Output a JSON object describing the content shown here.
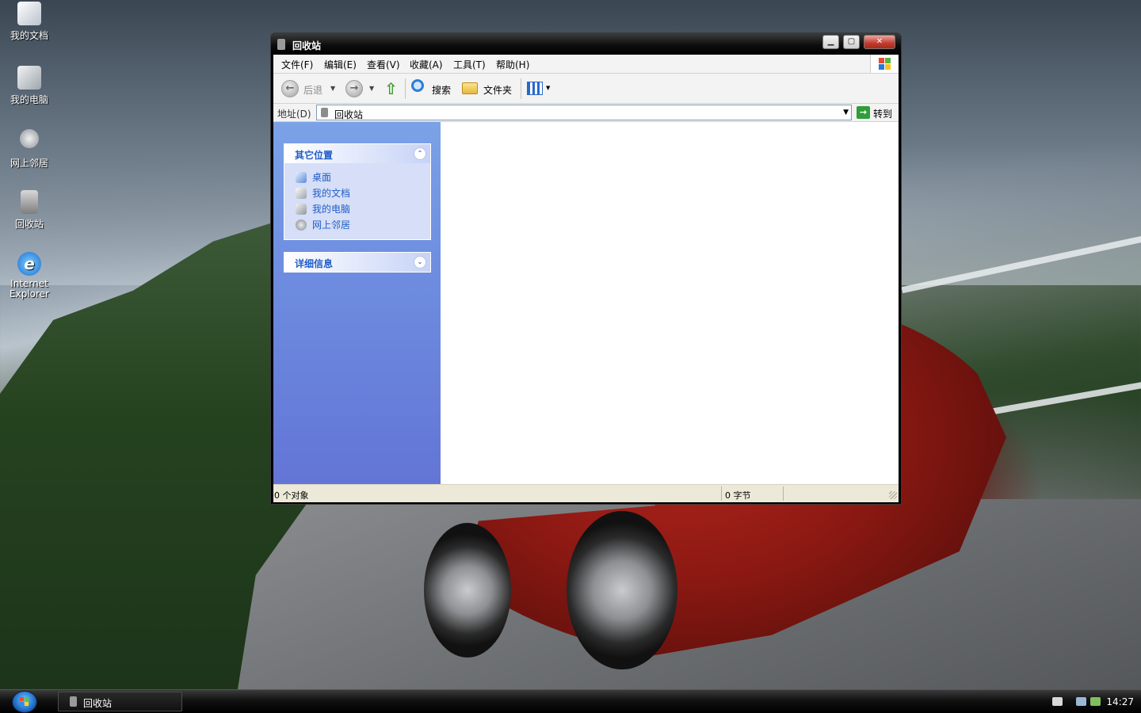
{
  "desktop": {
    "icons": [
      {
        "label": "我的文档"
      },
      {
        "label": "我的电脑"
      },
      {
        "label": "网上邻居"
      },
      {
        "label": "回收站"
      },
      {
        "label": "Internet Explorer"
      }
    ]
  },
  "window": {
    "title": "回收站",
    "menu": [
      "文件(F)",
      "编辑(E)",
      "查看(V)",
      "收藏(A)",
      "工具(T)",
      "帮助(H)"
    ],
    "toolbar": {
      "back_label": "后退",
      "search_label": "搜索",
      "folders_label": "文件夹"
    },
    "address": {
      "label": "地址(D)",
      "value": "回收站",
      "go_label": "转到"
    },
    "sidebar": {
      "panel1": {
        "title": "其它位置",
        "links": [
          {
            "label": "桌面",
            "icon": "desktop-icon"
          },
          {
            "label": "我的文档",
            "icon": "my-documents-icon"
          },
          {
            "label": "我的电脑",
            "icon": "my-computer-icon"
          },
          {
            "label": "网上邻居",
            "icon": "network-places-icon"
          }
        ]
      },
      "panel2": {
        "title": "详细信息"
      }
    },
    "status": {
      "objects": "0 个对象",
      "bytes": "0 字节"
    }
  },
  "taskbar": {
    "task_label": "回收站",
    "clock": "14:27"
  },
  "colors": {
    "link_blue": "#215dc6",
    "sidebar_top": "#7ba2e7",
    "sidebar_bottom": "#6375d6",
    "close_red": "#c33a2d"
  }
}
